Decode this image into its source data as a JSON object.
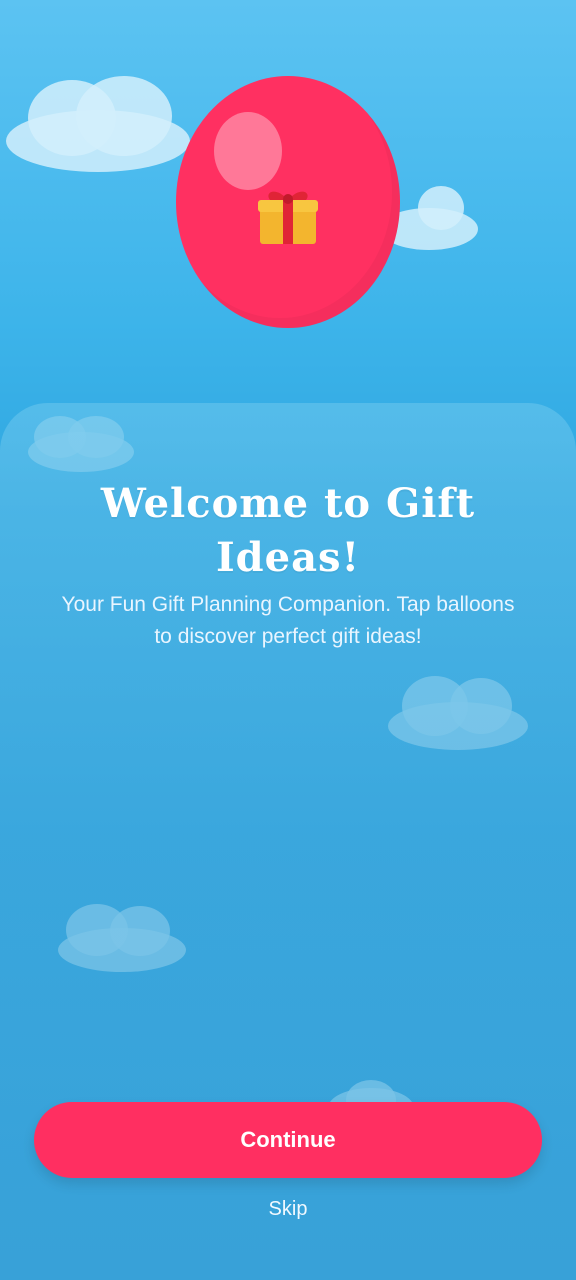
{
  "welcome": {
    "title": "Welcome to Gift Ideas!",
    "subtitle": "Your Fun Gift Planning Companion. Tap balloons to discover perfect gift ideas!"
  },
  "balloon": {
    "icon": "gift-icon",
    "color": "#ff3061"
  },
  "actions": {
    "continue_label": "Continue",
    "skip_label": "Skip"
  },
  "colors": {
    "sky": "#3db4ea",
    "accent": "#ff2f61"
  }
}
